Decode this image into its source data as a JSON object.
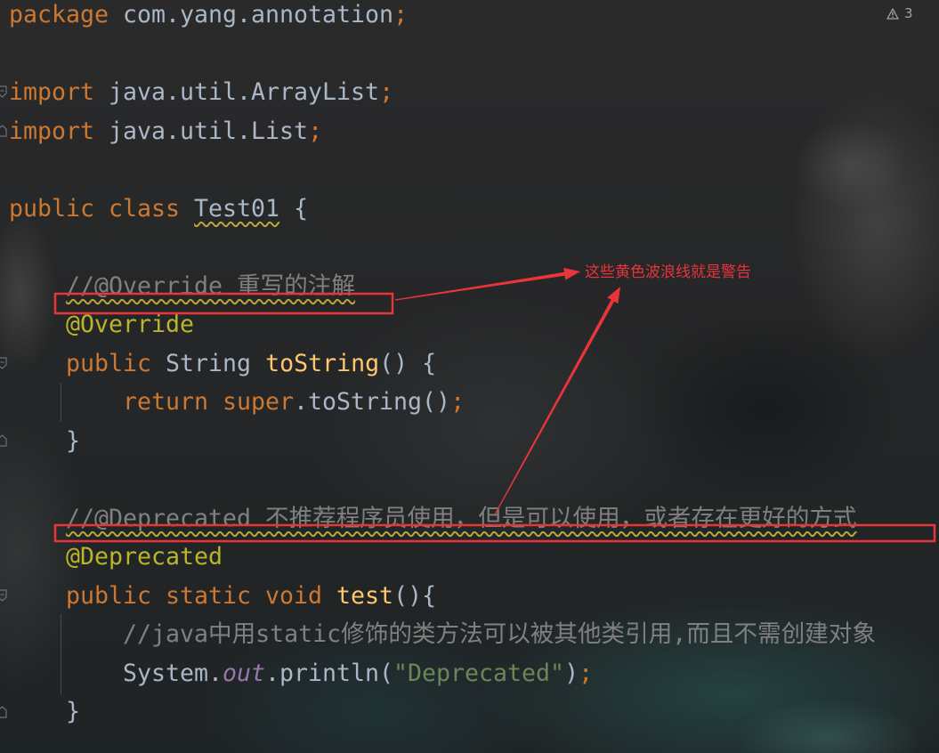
{
  "theme": {
    "keyword": "#CC7832",
    "text": "#A9B7C6",
    "method": "#FFC66D",
    "annotation": "#BBB529",
    "comment": "#808080",
    "string": "#6A8759",
    "static_field": "#9876AA",
    "warning": "#B9A93A",
    "callout": "#E8353A"
  },
  "editor": {
    "inspection": {
      "icon": "warning-triangle-icon",
      "count": "3"
    },
    "lines": [
      {
        "tokens": [
          "package",
          "com.yang.annotation",
          ";"
        ]
      },
      {
        "tokens": [
          "import",
          "java.util.ArrayList",
          ";"
        ]
      },
      {
        "tokens": [
          "import",
          "java.util.List",
          ";"
        ]
      },
      {
        "tokens": [
          "public class",
          "Test01",
          "{"
        ]
      },
      {
        "tokens": [
          "//@Override 重写的注解"
        ]
      },
      {
        "tokens": [
          "@Override"
        ]
      },
      {
        "tokens": [
          "public",
          "String",
          "toString",
          "() {"
        ]
      },
      {
        "tokens": [
          "return",
          "super",
          ".toString()",
          ";"
        ]
      },
      {
        "tokens": [
          "}"
        ]
      },
      {
        "tokens": [
          "//@Deprecated 不推荐程序员使用，但是可以使用，或者存在更好的方式"
        ]
      },
      {
        "tokens": [
          "@Deprecated"
        ]
      },
      {
        "tokens": [
          "public static void",
          "test",
          "(){"
        ]
      },
      {
        "tokens": [
          "//java中用static修饰的类方法可以被其他类引用,而且不需创建对象"
        ]
      },
      {
        "tokens": [
          "System.",
          "out",
          ".println(",
          "\"Deprecated\"",
          ")",
          ";"
        ]
      },
      {
        "tokens": [
          "}"
        ]
      }
    ]
  },
  "annotation": {
    "note": "这些黄色波浪线就是警告"
  }
}
